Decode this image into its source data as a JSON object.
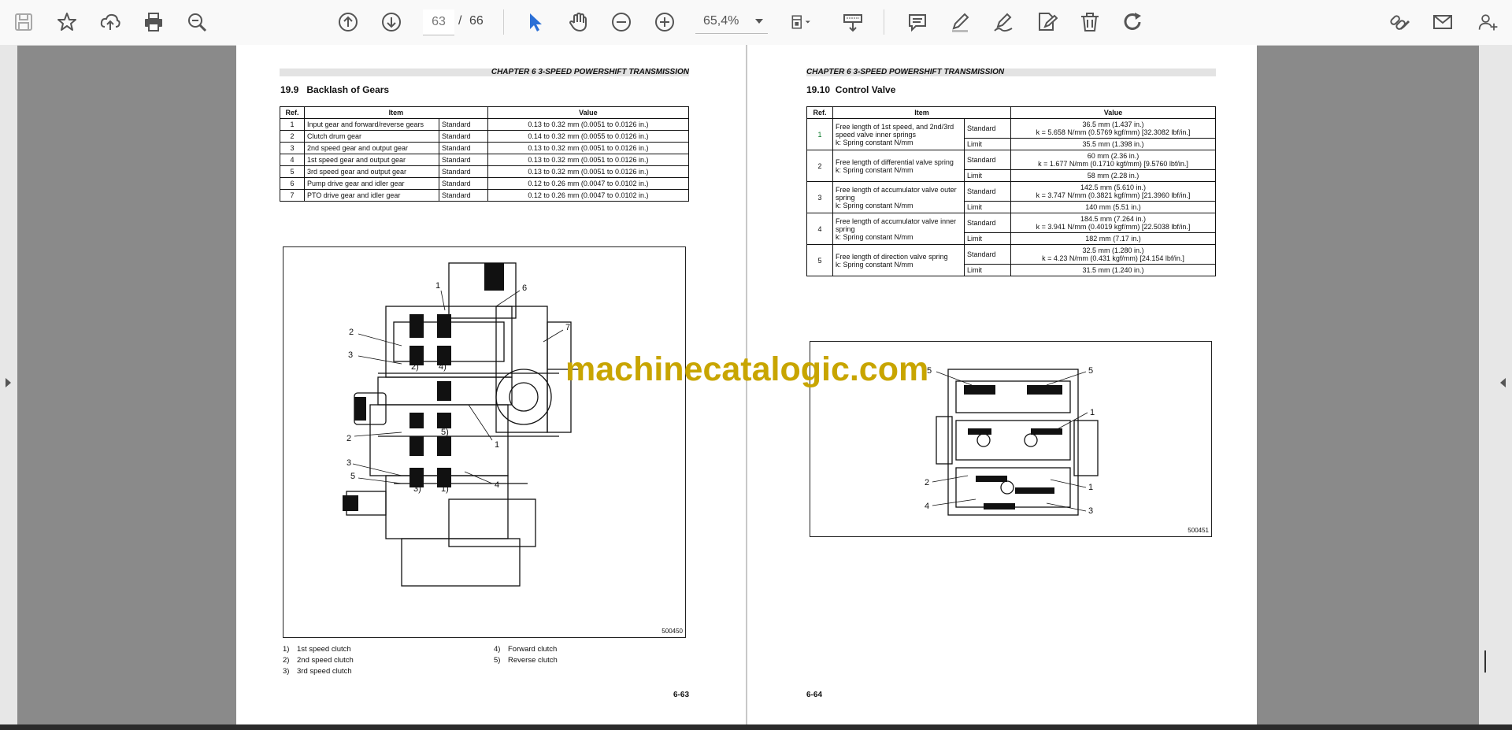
{
  "toolbar": {
    "page_current": "63",
    "page_sep": "/",
    "page_total": "66",
    "zoom": "65,4%"
  },
  "watermark": "machinecatalogic.com",
  "left_page": {
    "chapter": "CHAPTER 6 3-SPEED POWERSHIFT TRANSMISSION",
    "section": "19.9",
    "section_title": "Backlash of Gears",
    "table": {
      "headers": [
        "Ref.",
        "Item",
        "Value"
      ],
      "rows": [
        [
          "1",
          "Input gear and forward/reverse gears",
          "Standard",
          "0.13 to 0.32 mm (0.0051 to 0.0126 in.)"
        ],
        [
          "2",
          "Clutch drum gear",
          "Standard",
          "0.14 to 0.32 mm (0.0055 to 0.0126 in.)"
        ],
        [
          "3",
          "2nd speed gear and output gear",
          "Standard",
          "0.13 to 0.32 mm (0.0051 to 0.0126 in.)"
        ],
        [
          "4",
          "1st speed gear and output gear",
          "Standard",
          "0.13 to 0.32 mm (0.0051 to 0.0126 in.)"
        ],
        [
          "5",
          "3rd speed gear and output gear",
          "Standard",
          "0.13 to 0.32 mm (0.0051 to 0.0126 in.)"
        ],
        [
          "6",
          "Pump drive gear and idler gear",
          "Standard",
          "0.12 to 0.26 mm (0.0047 to 0.0102 in.)"
        ],
        [
          "7",
          "PTO drive gear and idler gear",
          "Standard",
          "0.12 to 0.26 mm (0.0047 to 0.0102 in.)"
        ]
      ]
    },
    "figure_id": "500450",
    "callouts": [
      "1",
      "2",
      "3",
      "2)",
      "4)",
      "6",
      "7",
      "2",
      "3",
      "5",
      "5)",
      "1",
      "4",
      "3)",
      "1)"
    ],
    "legend": [
      {
        "num": "1)",
        "text": "1st speed clutch"
      },
      {
        "num": "2)",
        "text": "2nd speed clutch"
      },
      {
        "num": "3)",
        "text": "3rd speed clutch"
      },
      {
        "num": "4)",
        "text": "Forward clutch"
      },
      {
        "num": "5)",
        "text": "Reverse clutch"
      }
    ],
    "folio": "6-63"
  },
  "right_page": {
    "chapter": "CHAPTER 6 3-SPEED POWERSHIFT TRANSMISSION",
    "section": "19.10",
    "section_title": "Control Valve",
    "table": {
      "headers": [
        "Ref.",
        "Item",
        "Value"
      ],
      "rows": [
        {
          "ref": "1",
          "item": "Free length of 1st speed, and 2nd/3rd speed valve inner springs",
          "item2": "k: Spring constant N/mm",
          "std_label": "Standard",
          "std_1": "36.5 mm (1.437 in.)",
          "std_2": "k = 5.658 N/mm (0.5769 kgf/mm) [32.3082 lbf/in.]",
          "lim_label": "Limit",
          "lim": "35.5 mm (1.398 in.)"
        },
        {
          "ref": "2",
          "item": "Free length of differential valve spring",
          "item2": "k: Spring constant N/mm",
          "std_label": "Standard",
          "std_1": "60 mm (2.36 in.)",
          "std_2": "k = 1.677 N/mm (0.1710 kgf/mm) [9.5760 lbf/in.]",
          "lim_label": "Limit",
          "lim": "58 mm (2.28 in.)"
        },
        {
          "ref": "3",
          "item": "Free length of accumulator valve outer spring",
          "item2": "k: Spring constant N/mm",
          "std_label": "Standard",
          "std_1": "142.5 mm (5.610 in.)",
          "std_2": "k = 3.747 N/mm (0.3821 kgf/mm) [21.3960 lbf/in.]",
          "lim_label": "Limit",
          "lim": "140 mm (5.51 in.)"
        },
        {
          "ref": "4",
          "item": "Free length of accumulator valve inner spring",
          "item2": "k: Spring constant N/mm",
          "std_label": "Standard",
          "std_1": "184.5 mm (7.264 in.)",
          "std_2": "k = 3.941 N/mm (0.4019 kgf/mm) [22.5038 lbf/in.]",
          "lim_label": "Limit",
          "lim": "182 mm (7.17 in.)"
        },
        {
          "ref": "5",
          "item": "Free length of direction valve spring",
          "item2": "k: Spring constant N/mm",
          "std_label": "Standard",
          "std_1": "32.5 mm (1.280 in.)",
          "std_2": "k = 4.23 N/mm (0.431 kgf/mm) [24.154 lbf/in.]",
          "lim_label": "Limit",
          "lim": "31.5 mm (1.240 in.)"
        }
      ]
    },
    "figure_id": "500451",
    "callouts": [
      "5",
      "5",
      "1",
      "2",
      "1",
      "4",
      "3"
    ],
    "folio": "6-64"
  }
}
